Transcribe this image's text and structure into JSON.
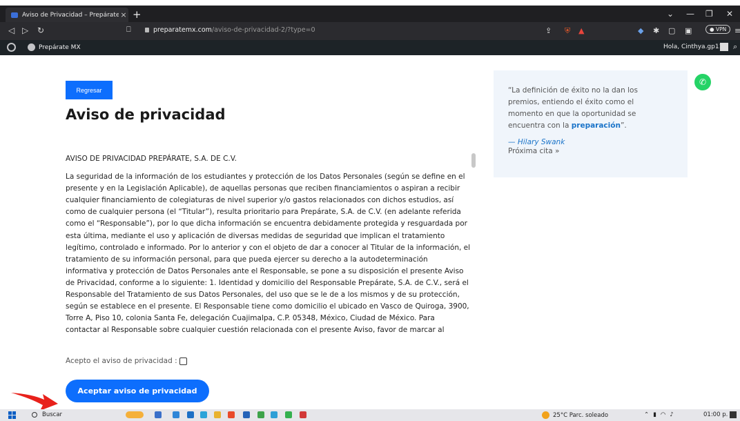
{
  "browser": {
    "tab_title": "Aviso de Privacidad – Prepárate M",
    "tab_close": "×",
    "new_tab": "+",
    "url_host": "preparatemx.com",
    "url_path": "/aviso-de-privacidad-2/?type=0",
    "vpn_label": "VPN"
  },
  "wp_admin_bar": {
    "site_name": "Prepárate MX",
    "greeting": "Hola, Cinthya.gp11"
  },
  "page": {
    "back_button": "Regresar",
    "title": "Aviso de privacidad",
    "terms_heading": "AVISO DE PRIVACIDAD PREPÁRATE, S.A. DE C.V.",
    "terms_body": "La seguridad de la información de los estudiantes y protección de los Datos Personales (según se define en el presente y en la Legislación Aplicable), de aquellas personas que reciben financiamientos o aspiran a recibir cualquier financiamiento de colegiaturas de nivel superior y/o gastos relacionados con dichos estudios, así como de cualquier persona (el “Titular”), resulta prioritario para Prepárate, S.A. de C.V. (en adelante referida como el “Responsable”), por lo que dicha información se encuentra debidamente protegida y resguardada por esta última, mediante el uso y aplicación de diversas medidas de seguridad que implican el tratamiento legítimo, controlado e informado. Por lo anterior y con el objeto de dar a conocer al Titular de la información, el tratamiento de su información personal, para que pueda ejercer su derecho a la autodeterminación informativa y protección de Datos Personales ante el Responsable, se pone a su disposición el presente Aviso de Privacidad, conforme a lo siguiente: 1. Identidad y domicilio del Responsable Prepárate, S.A. de C.V., será el Responsable del Tratamiento de sus Datos Personales, del uso que se le de a los mismos y de su protección, según se establece en el presente. El Responsable tiene como domicilio el ubicado en Vasco de Quiroga, 3900, Torre A, Piso 10, colonia Santa Fe, delegación Cuajimalpa, C.P. 05348, México, Ciudad de México. Para contactar al Responsable sobre cualquier cuestión relacionada con el presente Aviso, favor de marcar al",
    "accept_checkbox_label": "Acepto el aviso de privacidad :",
    "accept_checkbox_checked": false,
    "accept_button": "Aceptar aviso de privacidad"
  },
  "quote": {
    "text_before": "“La definición de éxito no la dan los premios, entiendo el éxito como el momento en que la oportunidad se encuentra con la ",
    "highlight": "preparación",
    "text_after": "”.",
    "author": "— Hilary Swank",
    "next_link": "Próxima cita »"
  },
  "taskbar": {
    "search_label": "Buscar",
    "weather": "25°C  Parc. soleado",
    "time": "01:00 p. m."
  },
  "colors": {
    "primary": "#0d6efd",
    "whatsapp": "#25d366",
    "quote_bg": "#f0f5fb",
    "arrow": "#e8211b"
  }
}
